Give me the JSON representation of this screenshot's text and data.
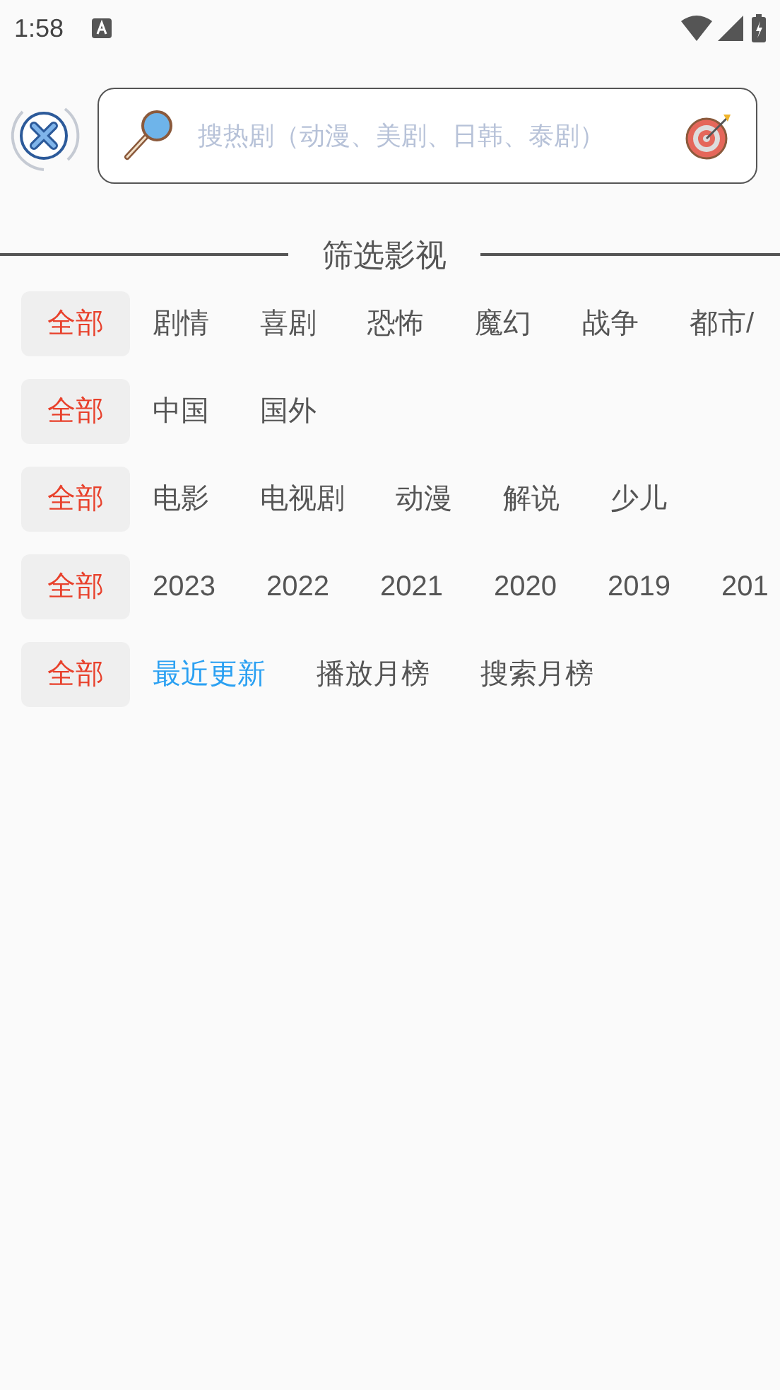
{
  "status_bar": {
    "time": "1:58"
  },
  "search": {
    "placeholder": "搜热剧（动漫、美剧、日韩、泰剧）"
  },
  "section_title": "筛选影视",
  "filter_rows": [
    {
      "all": {
        "label": "全部",
        "selected": true
      },
      "options": [
        {
          "label": "剧情",
          "selected": false
        },
        {
          "label": "喜剧",
          "selected": false
        },
        {
          "label": "恐怖",
          "selected": false
        },
        {
          "label": "魔幻",
          "selected": false
        },
        {
          "label": "战争",
          "selected": false
        },
        {
          "label": "都市/",
          "selected": false
        }
      ]
    },
    {
      "all": {
        "label": "全部",
        "selected": true
      },
      "options": [
        {
          "label": "中国",
          "selected": false
        },
        {
          "label": "国外",
          "selected": false
        }
      ]
    },
    {
      "all": {
        "label": "全部",
        "selected": true
      },
      "options": [
        {
          "label": "电影",
          "selected": false
        },
        {
          "label": "电视剧",
          "selected": false
        },
        {
          "label": "动漫",
          "selected": false
        },
        {
          "label": "解说",
          "selected": false
        },
        {
          "label": "少儿",
          "selected": false
        }
      ]
    },
    {
      "all": {
        "label": "全部",
        "selected": true
      },
      "options": [
        {
          "label": "2023",
          "selected": false
        },
        {
          "label": "2022",
          "selected": false
        },
        {
          "label": "2021",
          "selected": false
        },
        {
          "label": "2020",
          "selected": false
        },
        {
          "label": "2019",
          "selected": false
        },
        {
          "label": "201",
          "selected": false
        }
      ]
    },
    {
      "all": {
        "label": "全部",
        "selected": true
      },
      "options": [
        {
          "label": "最近更新",
          "selected": true
        },
        {
          "label": "播放月榜",
          "selected": false
        },
        {
          "label": "搜索月榜",
          "selected": false
        }
      ]
    }
  ]
}
